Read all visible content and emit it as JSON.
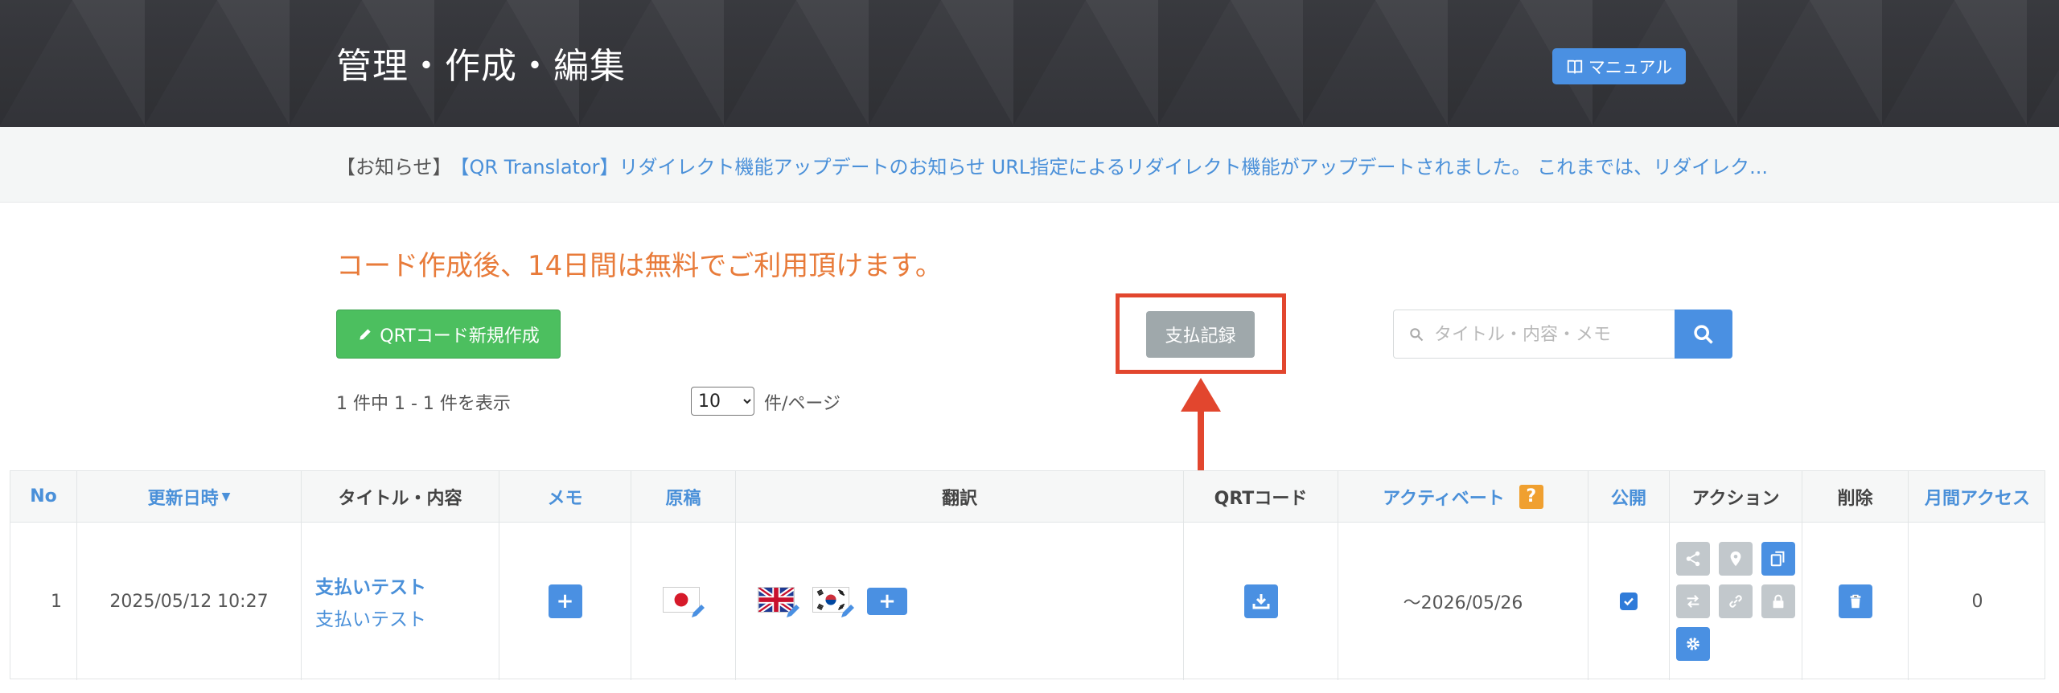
{
  "header": {
    "title": "管理・作成・編集",
    "manual_button": "マニュアル",
    "manual_icon": "book-icon"
  },
  "notice": {
    "tag": "【お知らせ】",
    "link": "【QR Translator】リダイレクト機能アップデートのお知らせ URL指定によるリダイレクト機能がアップデートされました。 これまでは、リダイレク..."
  },
  "main": {
    "free_message": "コード作成後、14日間は無料でご利用頂けます。",
    "new_button": "QRTコード新規作成",
    "payment_button": "支払記録",
    "search_placeholder": "タイトル・内容・メモ",
    "count_text": "1 件中 1 - 1 件を表示",
    "per_page_value": "10",
    "per_page_options": [
      "10"
    ],
    "per_page_label": "件/ページ",
    "highlight_color": "#e2462e"
  },
  "table": {
    "headers": {
      "no": "No",
      "updated": "更新日時",
      "title": "タイトル・内容",
      "memo": "メモ",
      "original": "原稿",
      "translation": "翻訳",
      "qrt": "QRTコード",
      "activate": "アクティベート",
      "activate_help": "?",
      "public": "公開",
      "action": "アクション",
      "delete": "削除",
      "monthly": "月間アクセス"
    },
    "rows": [
      {
        "no": "1",
        "updated": "2025/05/12 10:27",
        "title": "支払いテスト",
        "content": "支払いテスト",
        "memo_add": "+",
        "original_flag": "japan-flag-icon",
        "translation_flags": [
          "uk-flag-icon",
          "korea-flag-icon"
        ],
        "translation_add": "+",
        "activate_until": "〜2026/05/26",
        "public": true,
        "monthly_access": "0"
      }
    ]
  }
}
